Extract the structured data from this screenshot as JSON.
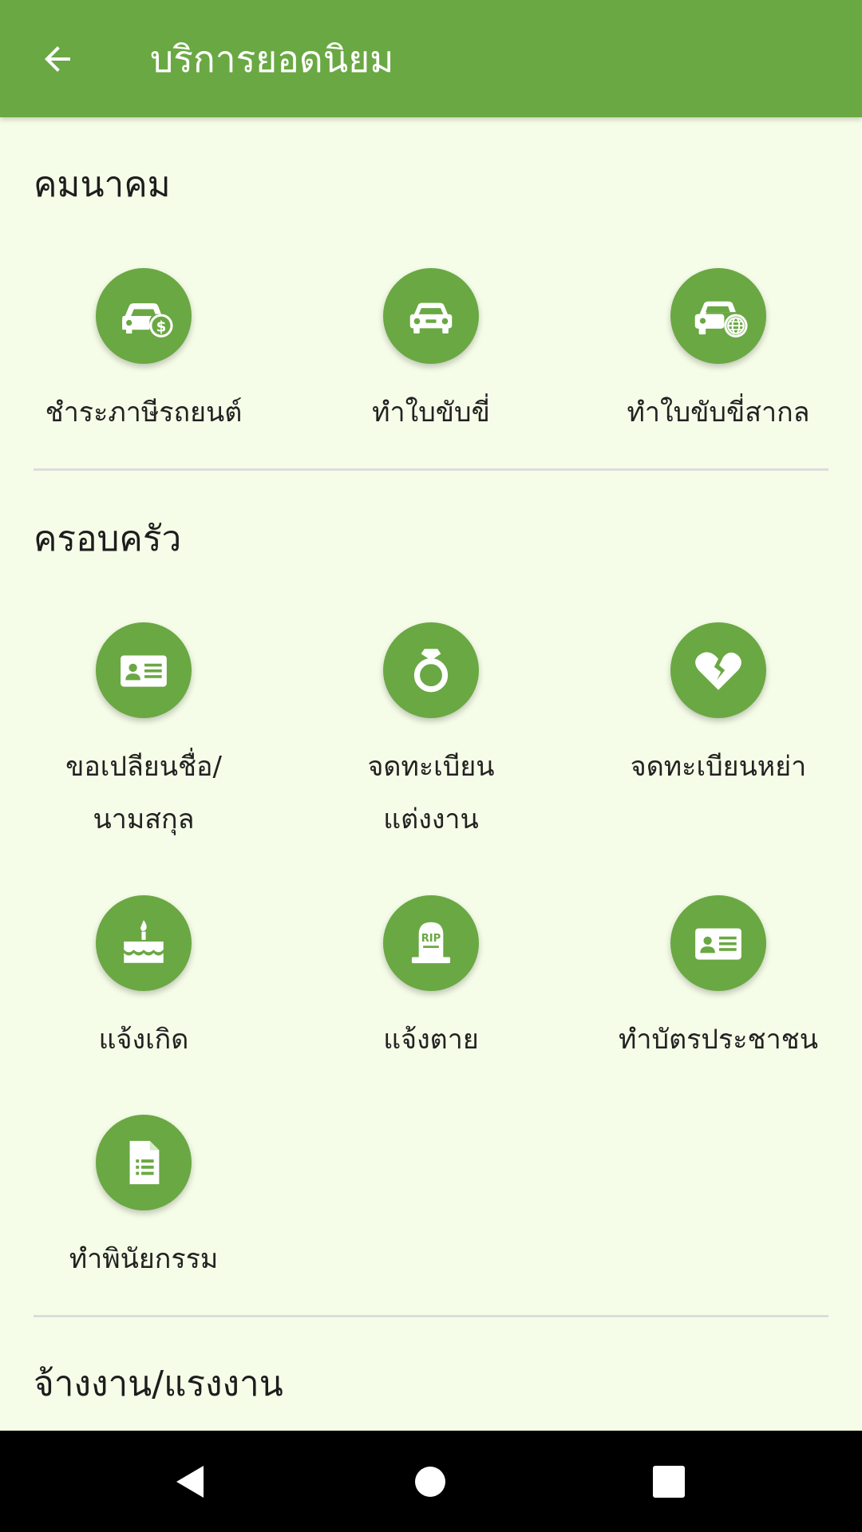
{
  "appbar": {
    "title": "บริการยอดนิยม",
    "color": "#6aa843"
  },
  "sections": [
    {
      "title": "คมนาคม",
      "items": [
        {
          "label": "ชำระภาษีรถยนต์",
          "icon": "car-payment-icon"
        },
        {
          "label": "ทำใบขับขี่",
          "icon": "car-icon"
        },
        {
          "label": "ทำใบขับขี่สากล",
          "icon": "car-globe-icon"
        }
      ]
    },
    {
      "title": "ครอบครัว",
      "items": [
        {
          "label": "ขอเปลียนชื่อ/\nนามสกุล",
          "icon": "id-card-icon"
        },
        {
          "label": "จดทะเบียน\nแต่งงาน",
          "icon": "ring-icon"
        },
        {
          "label": "จดทะเบียนหย่า",
          "icon": "broken-heart-icon"
        },
        {
          "label": "แจ้งเกิด",
          "icon": "birthday-cake-icon"
        },
        {
          "label": "แจ้งตาย",
          "icon": "tombstone-icon"
        },
        {
          "label": "ทำบัตรประชาชน",
          "icon": "id-card-icon"
        },
        {
          "label": "ทำพินัยกรรม",
          "icon": "document-icon"
        }
      ]
    },
    {
      "title": "จ้างงาน/แรงงาน",
      "items": []
    }
  ]
}
